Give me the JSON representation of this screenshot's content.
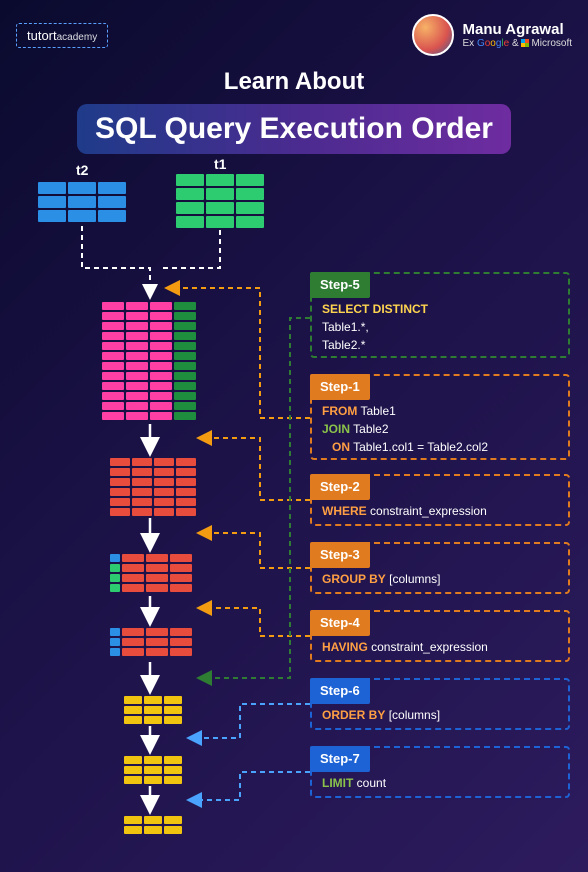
{
  "header": {
    "brand_main": "tutort",
    "brand_sub": "academy",
    "author_name": "Manu Agrawal",
    "author_prefix": "Ex",
    "author_amp": "&",
    "ms_label": "Microsoft"
  },
  "title": {
    "line1": "Learn About",
    "line2": "SQL Query Execution Order"
  },
  "tables": {
    "t1_label": "t1",
    "t2_label": "t2"
  },
  "steps": {
    "s5": {
      "tag": "Step-5",
      "kw": "SELECT DISTINCT",
      "l1": "Table1.*,",
      "l2": "Table2.*"
    },
    "s1": {
      "tag": "Step-1",
      "kw_from": "FROM",
      "from_t": "Table1",
      "kw_join": "JOIN",
      "join_t": "Table2",
      "kw_on": "ON",
      "on_expr": "Table1.col1 = Table2.col2"
    },
    "s2": {
      "tag": "Step-2",
      "kw": "WHERE",
      "expr": "constraint_expression"
    },
    "s3": {
      "tag": "Step-3",
      "kw": "GROUP BY",
      "expr": "[columns]"
    },
    "s4": {
      "tag": "Step-4",
      "kw": "HAVING",
      "expr": "constraint_expression"
    },
    "s6": {
      "tag": "Step-6",
      "kw": "ORDER BY",
      "expr": "[columns]"
    },
    "s7": {
      "tag": "Step-7",
      "kw": "LIMIT",
      "expr": "count"
    }
  },
  "colors": {
    "step5": "#2e7d32",
    "step1": "#e07b1f",
    "step234": "#e07b1f",
    "step67": "#1e63d6"
  }
}
